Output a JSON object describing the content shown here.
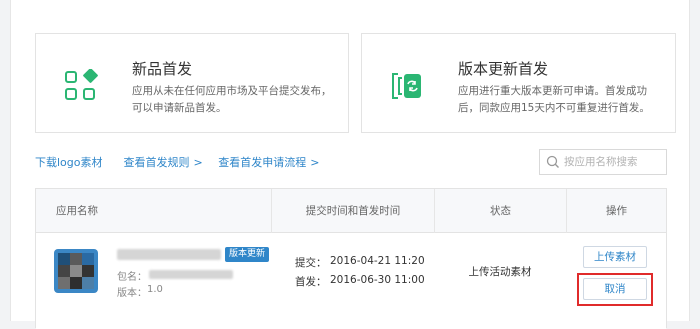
{
  "cards": [
    {
      "title": "新品首发",
      "desc": "应用从未在任何应用市场及平台提交发布，可以申请新品首发。",
      "icon": "grid-diamond-icon",
      "accent": "#2bb673"
    },
    {
      "title": "版本更新首发",
      "desc": "应用进行重大版本更新可申请。首发成功后，同款应用15天内不可重复进行首发。",
      "icon": "refresh-update-icon",
      "accent": "#2bb673"
    }
  ],
  "links": {
    "download": "下载logo素材",
    "rules": "查看首发规则",
    "process": "查看首发申请流程",
    "chevron": ">"
  },
  "search": {
    "placeholder": "按应用名称搜索"
  },
  "table": {
    "headers": {
      "app": "应用名称",
      "time": "提交时间和首发时间",
      "status": "状态",
      "action": "操作"
    },
    "rows": [
      {
        "badge": "版本更新",
        "package_label": "包名：",
        "version_label": "版本：",
        "version": "1.0",
        "submit_label": "提交：",
        "submit_time": "2016-04-21 11:20",
        "launch_label": "首发：",
        "launch_time": "2016-06-30 11:00",
        "status": "上传活动素材",
        "upload_button": "上传素材",
        "cancel_button": "取消"
      }
    ]
  },
  "colors": {
    "link": "#2f86c9",
    "badge": "#2f86c9",
    "highlight": "#e02b2b"
  }
}
